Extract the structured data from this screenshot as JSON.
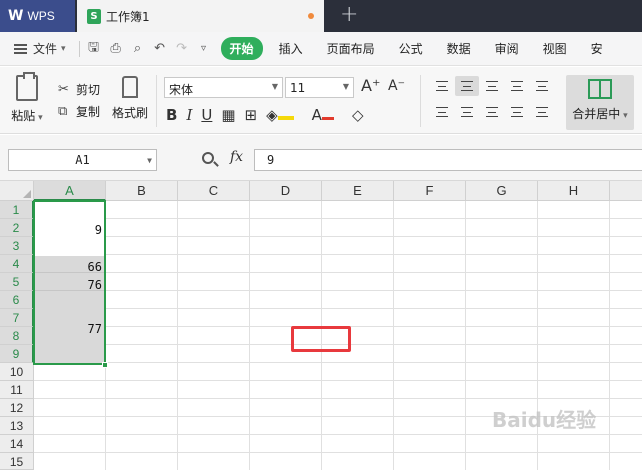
{
  "titlebar": {
    "app_label": "WPS",
    "doc_tab": "工作簿1"
  },
  "menu": {
    "file": "文件",
    "tabs": [
      "开始",
      "插入",
      "页面布局",
      "公式",
      "数据",
      "审阅",
      "视图",
      "安"
    ]
  },
  "ribbon": {
    "paste": "粘贴",
    "cut": "剪切",
    "copy": "复制",
    "format_painter": "格式刷",
    "font_name": "宋体",
    "font_size": "11",
    "merge_center": "合并居中"
  },
  "formula_bar": {
    "cell_ref": "A1",
    "fx_label": "fx",
    "value": "9"
  },
  "sheet": {
    "columns": [
      "A",
      "B",
      "C",
      "D",
      "E",
      "F",
      "G",
      "H"
    ],
    "rows": [
      "1",
      "2",
      "3",
      "4",
      "5",
      "6",
      "7",
      "8",
      "9",
      "10",
      "11",
      "12",
      "13",
      "14",
      "15"
    ],
    "cells": [
      {
        "ref": "A2",
        "value": "9"
      },
      {
        "ref": "A4",
        "value": "66"
      },
      {
        "ref": "A5",
        "value": "76"
      },
      {
        "ref": "A8",
        "value": "77"
      }
    ]
  },
  "watermark": "Baidu经验",
  "colors": {
    "accent_green": "#2fae5c",
    "selection_border": "#2a9a4a",
    "highlight_box": "#e8393d",
    "titlebar": "#2b2f3a"
  }
}
